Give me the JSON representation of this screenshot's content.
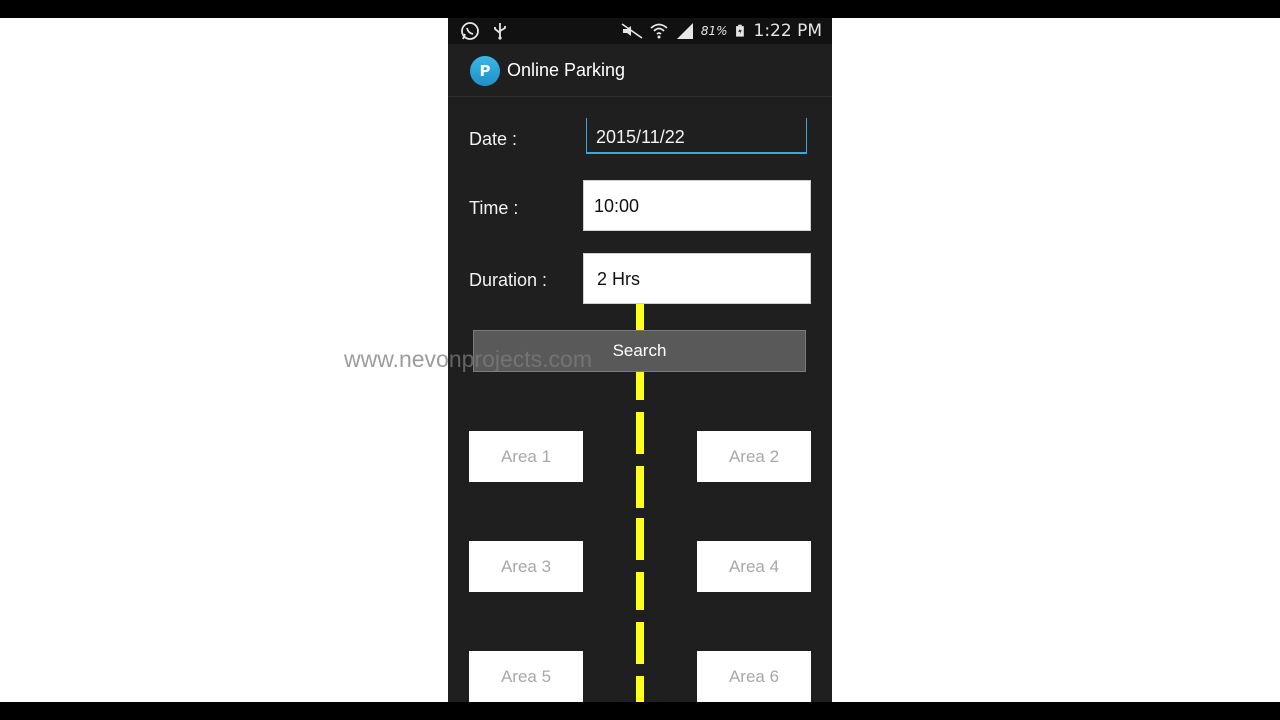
{
  "status_bar": {
    "left_icons": [
      "whatsapp-icon",
      "usb-icon"
    ],
    "right_icons": [
      "mute-icon",
      "wifi-icon",
      "signal-icon",
      "battery-icon"
    ],
    "battery_percent": "81%",
    "time": "1:22 PM"
  },
  "app": {
    "icon_letter": "P",
    "title": "Online Parking"
  },
  "form": {
    "date_label": "Date :",
    "date_value": "2015/11/22",
    "time_label": "Time :",
    "time_value": "10:00",
    "duration_label": "Duration :",
    "duration_value": "2 Hrs",
    "search_label": "Search"
  },
  "areas": [
    "Area 1",
    "Area 2",
    "Area 3",
    "Area 4",
    "Area 5",
    "Area 6"
  ],
  "watermark": "www.nevonprojects.com",
  "colors": {
    "background": "#1f1f1f",
    "accent": "#3aa7e0",
    "road_stripe": "#ffff1a"
  }
}
